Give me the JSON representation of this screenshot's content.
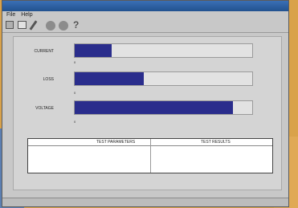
{
  "window": {
    "title": ""
  },
  "menu": [
    "File",
    "Help"
  ],
  "meters": [
    {
      "id": "current",
      "label": "CURRENT",
      "fill_fraction": 0.21,
      "value": "",
      "scale_min": "0",
      "scale_div": "",
      "scale_max": ""
    },
    {
      "id": "loss",
      "label": "LOSS",
      "fill_fraction": 0.39,
      "value": "",
      "scale_min": "0",
      "scale_div": "",
      "scale_max": ""
    },
    {
      "id": "voltage",
      "label": "VOLTAGE",
      "fill_fraction": 0.89,
      "value": "",
      "scale_min": "0",
      "scale_div": "",
      "scale_max": ""
    }
  ],
  "table": {
    "header_left": "TEST PARAMETERS",
    "header_right": "TEST RESULTS",
    "rows": [
      [
        "",
        "",
        "",
        ""
      ],
      [
        "",
        "",
        "",
        ""
      ],
      [
        "",
        "",
        "",
        ""
      ],
      [
        "",
        "",
        "",
        ""
      ]
    ]
  },
  "status_note": "",
  "statusbar": {
    "left": "",
    "right": ""
  },
  "colors": {
    "bar_fill": "#2a2d8c",
    "titlebar": "#2a5c9e",
    "panel": "#d4d4d4"
  }
}
